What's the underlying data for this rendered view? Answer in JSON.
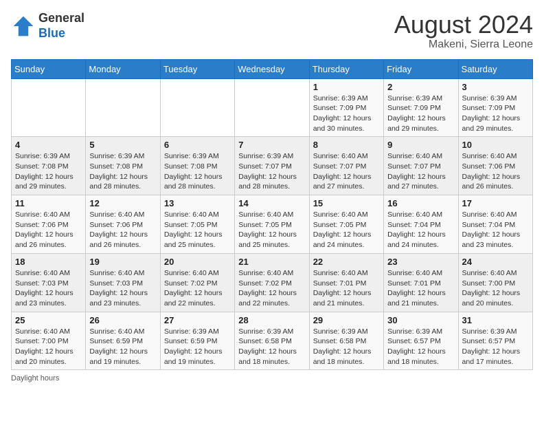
{
  "header": {
    "logo_general": "General",
    "logo_blue": "Blue",
    "month_year": "August 2024",
    "location": "Makeni, Sierra Leone"
  },
  "weekdays": [
    "Sunday",
    "Monday",
    "Tuesday",
    "Wednesday",
    "Thursday",
    "Friday",
    "Saturday"
  ],
  "weeks": [
    [
      {
        "day": "",
        "info": ""
      },
      {
        "day": "",
        "info": ""
      },
      {
        "day": "",
        "info": ""
      },
      {
        "day": "",
        "info": ""
      },
      {
        "day": "1",
        "info": "Sunrise: 6:39 AM\nSunset: 7:09 PM\nDaylight: 12 hours and 30 minutes."
      },
      {
        "day": "2",
        "info": "Sunrise: 6:39 AM\nSunset: 7:09 PM\nDaylight: 12 hours and 29 minutes."
      },
      {
        "day": "3",
        "info": "Sunrise: 6:39 AM\nSunset: 7:09 PM\nDaylight: 12 hours and 29 minutes."
      }
    ],
    [
      {
        "day": "4",
        "info": "Sunrise: 6:39 AM\nSunset: 7:08 PM\nDaylight: 12 hours and 29 minutes."
      },
      {
        "day": "5",
        "info": "Sunrise: 6:39 AM\nSunset: 7:08 PM\nDaylight: 12 hours and 28 minutes."
      },
      {
        "day": "6",
        "info": "Sunrise: 6:39 AM\nSunset: 7:08 PM\nDaylight: 12 hours and 28 minutes."
      },
      {
        "day": "7",
        "info": "Sunrise: 6:39 AM\nSunset: 7:07 PM\nDaylight: 12 hours and 28 minutes."
      },
      {
        "day": "8",
        "info": "Sunrise: 6:40 AM\nSunset: 7:07 PM\nDaylight: 12 hours and 27 minutes."
      },
      {
        "day": "9",
        "info": "Sunrise: 6:40 AM\nSunset: 7:07 PM\nDaylight: 12 hours and 27 minutes."
      },
      {
        "day": "10",
        "info": "Sunrise: 6:40 AM\nSunset: 7:06 PM\nDaylight: 12 hours and 26 minutes."
      }
    ],
    [
      {
        "day": "11",
        "info": "Sunrise: 6:40 AM\nSunset: 7:06 PM\nDaylight: 12 hours and 26 minutes."
      },
      {
        "day": "12",
        "info": "Sunrise: 6:40 AM\nSunset: 7:06 PM\nDaylight: 12 hours and 26 minutes."
      },
      {
        "day": "13",
        "info": "Sunrise: 6:40 AM\nSunset: 7:05 PM\nDaylight: 12 hours and 25 minutes."
      },
      {
        "day": "14",
        "info": "Sunrise: 6:40 AM\nSunset: 7:05 PM\nDaylight: 12 hours and 25 minutes."
      },
      {
        "day": "15",
        "info": "Sunrise: 6:40 AM\nSunset: 7:05 PM\nDaylight: 12 hours and 24 minutes."
      },
      {
        "day": "16",
        "info": "Sunrise: 6:40 AM\nSunset: 7:04 PM\nDaylight: 12 hours and 24 minutes."
      },
      {
        "day": "17",
        "info": "Sunrise: 6:40 AM\nSunset: 7:04 PM\nDaylight: 12 hours and 23 minutes."
      }
    ],
    [
      {
        "day": "18",
        "info": "Sunrise: 6:40 AM\nSunset: 7:03 PM\nDaylight: 12 hours and 23 minutes."
      },
      {
        "day": "19",
        "info": "Sunrise: 6:40 AM\nSunset: 7:03 PM\nDaylight: 12 hours and 23 minutes."
      },
      {
        "day": "20",
        "info": "Sunrise: 6:40 AM\nSunset: 7:02 PM\nDaylight: 12 hours and 22 minutes."
      },
      {
        "day": "21",
        "info": "Sunrise: 6:40 AM\nSunset: 7:02 PM\nDaylight: 12 hours and 22 minutes."
      },
      {
        "day": "22",
        "info": "Sunrise: 6:40 AM\nSunset: 7:01 PM\nDaylight: 12 hours and 21 minutes."
      },
      {
        "day": "23",
        "info": "Sunrise: 6:40 AM\nSunset: 7:01 PM\nDaylight: 12 hours and 21 minutes."
      },
      {
        "day": "24",
        "info": "Sunrise: 6:40 AM\nSunset: 7:00 PM\nDaylight: 12 hours and 20 minutes."
      }
    ],
    [
      {
        "day": "25",
        "info": "Sunrise: 6:40 AM\nSunset: 7:00 PM\nDaylight: 12 hours and 20 minutes."
      },
      {
        "day": "26",
        "info": "Sunrise: 6:40 AM\nSunset: 6:59 PM\nDaylight: 12 hours and 19 minutes."
      },
      {
        "day": "27",
        "info": "Sunrise: 6:39 AM\nSunset: 6:59 PM\nDaylight: 12 hours and 19 minutes."
      },
      {
        "day": "28",
        "info": "Sunrise: 6:39 AM\nSunset: 6:58 PM\nDaylight: 12 hours and 18 minutes."
      },
      {
        "day": "29",
        "info": "Sunrise: 6:39 AM\nSunset: 6:58 PM\nDaylight: 12 hours and 18 minutes."
      },
      {
        "day": "30",
        "info": "Sunrise: 6:39 AM\nSunset: 6:57 PM\nDaylight: 12 hours and 18 minutes."
      },
      {
        "day": "31",
        "info": "Sunrise: 6:39 AM\nSunset: 6:57 PM\nDaylight: 12 hours and 17 minutes."
      }
    ]
  ],
  "footer": {
    "note": "Daylight hours"
  }
}
